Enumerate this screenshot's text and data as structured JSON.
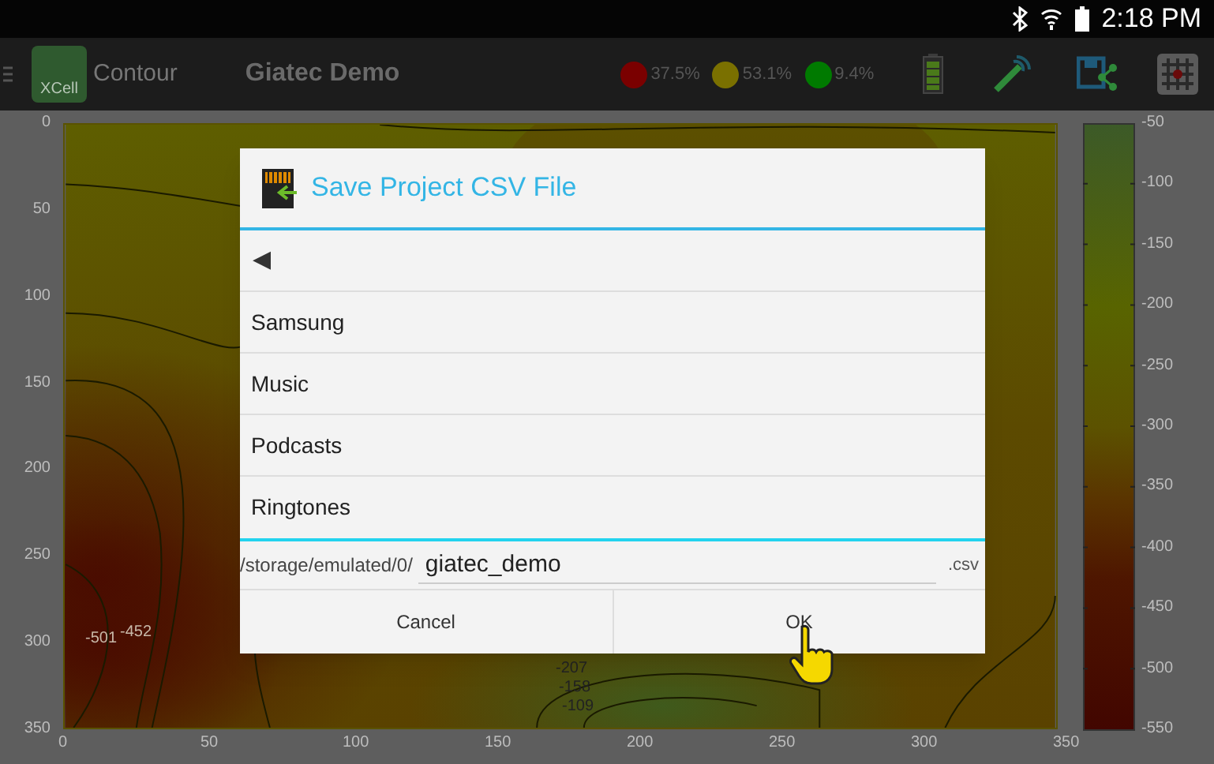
{
  "status_bar": {
    "time": "2:18 PM"
  },
  "app_bar": {
    "logo_text": "XCell",
    "screen": "Contour",
    "project": "Giatec Demo",
    "legend": [
      {
        "label": "37.5%",
        "color": "#7a0000"
      },
      {
        "label": "53.1%",
        "color": "#7a7000"
      },
      {
        "label": "9.4%",
        "color": "#007a00"
      }
    ]
  },
  "plot": {
    "y_ticks": [
      "0",
      "50",
      "100",
      "150",
      "200",
      "250",
      "300",
      "350"
    ],
    "x_ticks": [
      "0",
      "50",
      "100",
      "150",
      "200",
      "250",
      "300",
      "350"
    ],
    "contour_labels": [
      {
        "text": "-501",
        "kind": "left"
      },
      {
        "text": "-452",
        "kind": "left"
      },
      {
        "text": "-207",
        "kind": "bottom"
      },
      {
        "text": "-158",
        "kind": "bottom"
      },
      {
        "text": "-109",
        "kind": "bottom"
      }
    ],
    "colorbar_ticks": [
      "-50",
      "-100",
      "-150",
      "-200",
      "-250",
      "-300",
      "-350",
      "-400",
      "-450",
      "-500",
      "-550"
    ]
  },
  "dialog": {
    "title": "Save Project CSV File",
    "back": "◀",
    "folders": [
      "Samsung",
      "Music",
      "Podcasts",
      "Ringtones"
    ],
    "path": "/storage/emulated/0/",
    "file_name": "giatec_demo",
    "extension": ".csv",
    "buttons": [
      "Cancel",
      "OK"
    ]
  }
}
